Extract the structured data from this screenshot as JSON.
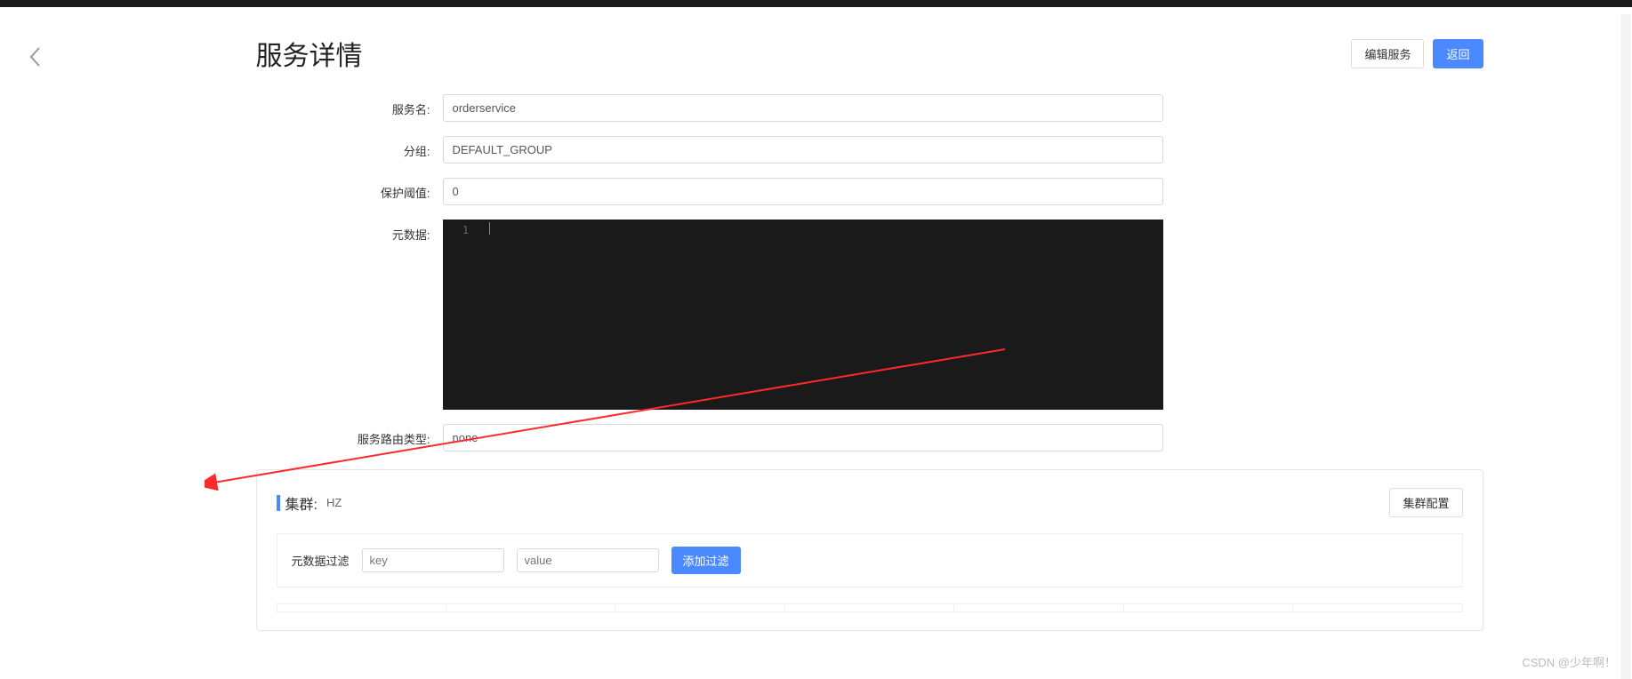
{
  "header": {
    "title": "服务详情",
    "edit_label": "编辑服务",
    "back_label": "返回"
  },
  "form": {
    "service_name": {
      "label": "服务名:",
      "value": "orderservice"
    },
    "group": {
      "label": "分组:",
      "value": "DEFAULT_GROUP"
    },
    "protect_threshold": {
      "label": "保护阈值:",
      "value": "0"
    },
    "metadata": {
      "label": "元数据:",
      "line_number": "1"
    },
    "route_type": {
      "label": "服务路由类型:",
      "value": "none"
    }
  },
  "cluster": {
    "label": "集群:",
    "name": "HZ",
    "config_label": "集群配置",
    "filter": {
      "label": "元数据过滤",
      "key_placeholder": "key",
      "value_placeholder": "value",
      "add_label": "添加过滤"
    }
  },
  "watermark": "CSDN @少年啊！"
}
